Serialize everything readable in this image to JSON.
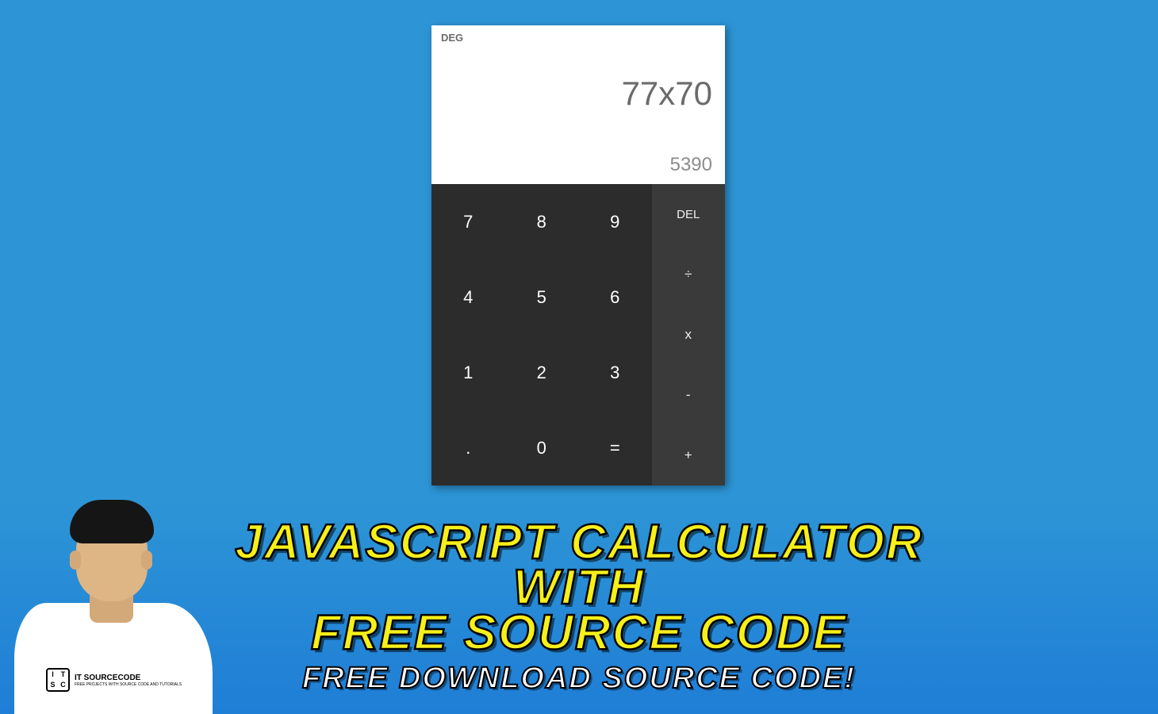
{
  "calculator": {
    "mode": "DEG",
    "expression": "77x70",
    "result": "5390",
    "numpad": [
      "7",
      "8",
      "9",
      "4",
      "5",
      "6",
      "1",
      "2",
      "3",
      ".",
      "0",
      "="
    ],
    "ops": {
      "del": "DEL",
      "div": "÷",
      "mul": "x",
      "sub": "-",
      "add": "+"
    }
  },
  "title": {
    "line1": "JAVASCRIPT CALCULATOR",
    "line2": "WITH",
    "line3": "FREE SOURCE CODE",
    "subtitle": "FREE DOWNLOAD SOURCE CODE!"
  },
  "host_logo": {
    "mark_tl": "I",
    "mark_tr": "T",
    "mark_bl": "S",
    "mark_br": "C",
    "brand": "IT SOURCECODE",
    "tagline": "FREE PROJECTS WITH SOURCE CODE AND TUTORIALS"
  }
}
